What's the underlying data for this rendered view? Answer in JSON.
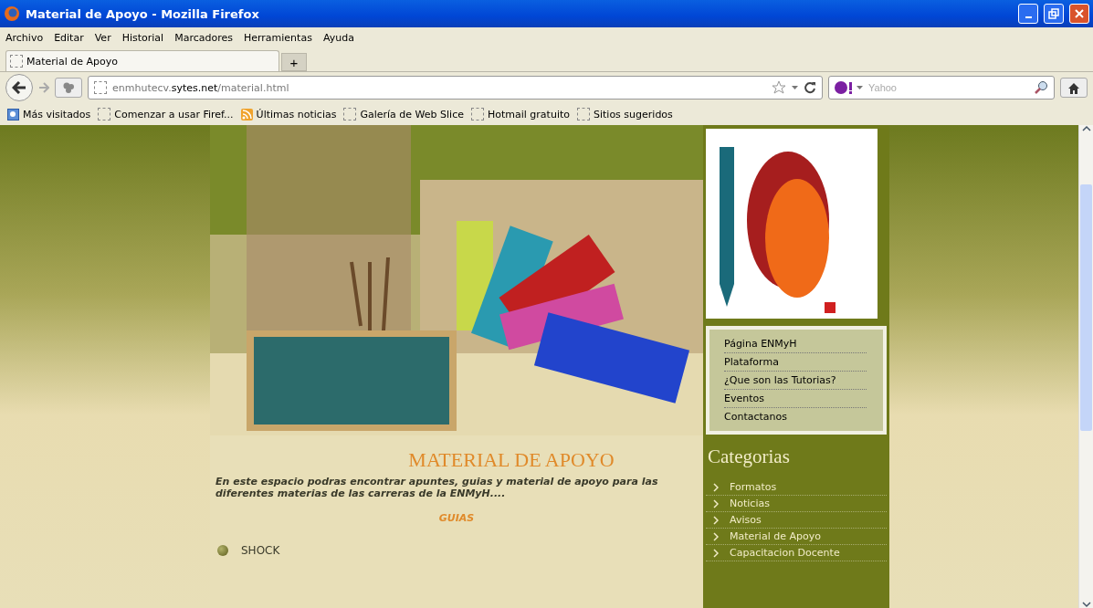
{
  "window": {
    "title": "Material de Apoyo - Mozilla Firefox"
  },
  "menu": [
    "Archivo",
    "Editar",
    "Ver",
    "Historial",
    "Marcadores",
    "Herramientas",
    "Ayuda"
  ],
  "tabs": [
    {
      "label": "Material de Apoyo",
      "selected": true
    }
  ],
  "new_tab": "+",
  "address": {
    "prefix": "enmhutecv.",
    "domain": "sytes.net",
    "path": "/material.html"
  },
  "search": {
    "placeholder": "Yahoo"
  },
  "bookmarks": [
    {
      "label": "Más visitados",
      "kind": "smart"
    },
    {
      "label": "Comenzar a usar Firef...",
      "kind": "page"
    },
    {
      "label": "Últimas noticias",
      "kind": "feed"
    },
    {
      "label": "Galería de Web Slice",
      "kind": "page"
    },
    {
      "label": "Hotmail gratuito",
      "kind": "page"
    },
    {
      "label": "Sitios sugeridos",
      "kind": "page"
    }
  ],
  "main": {
    "heading": "MATERIAL DE APOYO",
    "intro": "En este espacio podras encontrar apuntes, guias y material de apoyo para las diferentes materias de las carreras de la ENMyH....",
    "section": "GUIAS",
    "items": [
      "SHOCK"
    ]
  },
  "sidebar": {
    "nav": [
      "Página ENMyH",
      "Plataforma",
      "¿Que son las Tutorias?",
      "Eventos",
      "Contactanos"
    ],
    "categories_title": "Categorias",
    "categories": [
      "Formatos",
      "Noticias",
      "Avisos",
      "Material de Apoyo",
      "Capacitacion Docente"
    ]
  }
}
